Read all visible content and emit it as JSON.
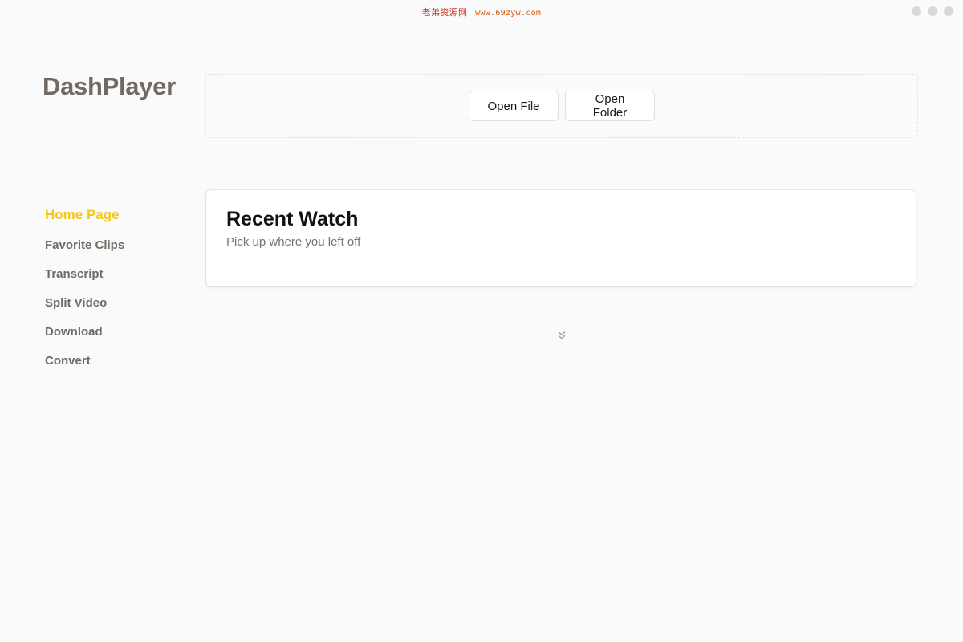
{
  "watermark": {
    "cn": "老弟资源网",
    "url": "www.69zyw.com"
  },
  "window_controls": [
    "window-dot",
    "window-dot",
    "window-dot"
  ],
  "brand": {
    "title": "DashPlayer"
  },
  "sidebar": {
    "items": [
      {
        "label": "Home Page",
        "active": true
      },
      {
        "label": "Favorite Clips",
        "active": false
      },
      {
        "label": "Transcript",
        "active": false
      },
      {
        "label": "Split Video",
        "active": false
      },
      {
        "label": "Download",
        "active": false
      },
      {
        "label": "Convert",
        "active": false
      }
    ]
  },
  "file_zone": {
    "open_file_label": "Open File",
    "open_folder_label": "Open Folder"
  },
  "recent": {
    "title": "Recent Watch",
    "subtitle": "Pick up where you left off"
  },
  "expand": {
    "icon": "chevrons-down-icon"
  },
  "colors": {
    "accent": "#f5c518",
    "brand_text": "#716963",
    "background": "#fafafa"
  }
}
